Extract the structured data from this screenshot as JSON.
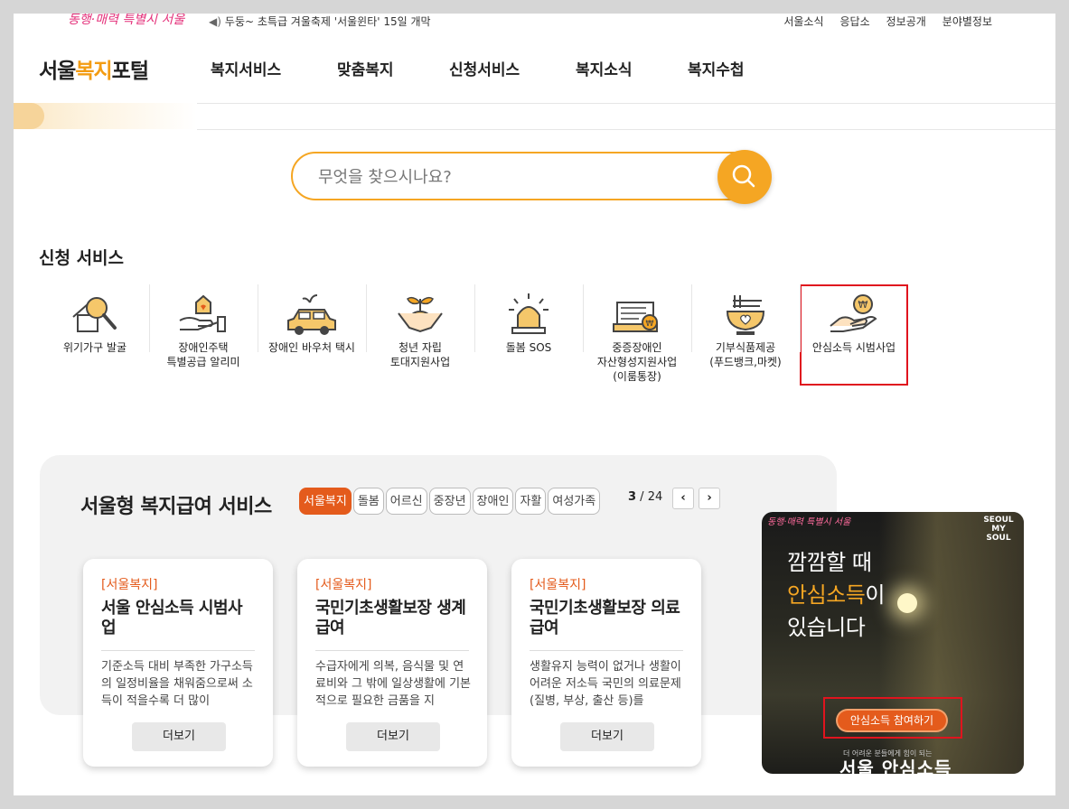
{
  "topbar": {
    "slogan": "동행·매력 특별시 서울",
    "notice": "두둥~ 초특급 겨울축제 '서울윈타' 15일 개막",
    "util_links": [
      "서울소식",
      "응답소",
      "정보공개",
      "분야별정보"
    ]
  },
  "header": {
    "logo_pre": "서울",
    "logo_hl": "복지",
    "logo_post": "포털",
    "nav": [
      "복지서비스",
      "맞춤복지",
      "신청서비스",
      "복지소식",
      "복지수첩"
    ]
  },
  "search": {
    "placeholder": "무엇을 찾으시나요?"
  },
  "apply": {
    "title": "신청 서비스",
    "items": [
      {
        "label": "위기가구 발굴",
        "icon": "magnifier-house-icon"
      },
      {
        "label": "장애인주택\n특별공급 알리미",
        "icon": "hand-house-icon"
      },
      {
        "label": "장애인 바우처 택시",
        "icon": "taxi-icon"
      },
      {
        "label": "청년 자립\n토대지원사업",
        "icon": "sprout-hands-icon"
      },
      {
        "label": "돌봄 SOS",
        "icon": "siren-icon"
      },
      {
        "label": "중증장애인\n자산형성지원사업\n(이룸통장)",
        "icon": "bankbook-icon"
      },
      {
        "label": "기부식품제공\n(푸드뱅크,마켓)",
        "icon": "food-bowl-icon"
      },
      {
        "label": "안심소득 시범사업",
        "icon": "hand-coin-icon"
      }
    ]
  },
  "benefit": {
    "title": "서울형 복지급여 서비스",
    "tabs": [
      "서울복지",
      "돌봄",
      "어르신",
      "중장년",
      "장애인",
      "자활",
      "여성가족"
    ],
    "active_tab": "서울복지",
    "page_current": "3",
    "page_sep": " / ",
    "page_total": "24",
    "prev_label": "‹",
    "next_label": "›",
    "cards": [
      {
        "tag": "[서울복지]",
        "title": "서울 안심소득 시범사업",
        "desc": "기준소득 대비 부족한 가구소득의 일정비율을 채워줌으로써 소득이 적을수록 더 많이",
        "more": "더보기"
      },
      {
        "tag": "[서울복지]",
        "title": "국민기초생활보장 생계급여",
        "desc": "수급자에게 의복, 음식물 및 연료비와 그 밖에 일상생활에 기본적으로 필요한 금품을 지",
        "more": "더보기"
      },
      {
        "tag": "[서울복지]",
        "title": "국민기초생활보장 의료급여",
        "desc": "생활유지 능력이 없거나 생활이 어려운 저소득 국민의 의료문제(질병, 부상, 출산 등)를",
        "more": "더보기"
      }
    ]
  },
  "banner": {
    "logo": "동행·매력 특별시 서울",
    "brand": "SEOUL MY SOUL",
    "line1": "깜깜할 때",
    "line2_hl": "안심소득",
    "line2_post": "이",
    "line3": "있습니다",
    "cta": "안심소득 참여하기",
    "sub": "더 어려운 분들에게 힘이 되는",
    "big": "서울 안심소득"
  },
  "colors": {
    "accent": "#f5a623",
    "tab_active": "#e45b1c",
    "highlight_box": "#e0141e"
  }
}
